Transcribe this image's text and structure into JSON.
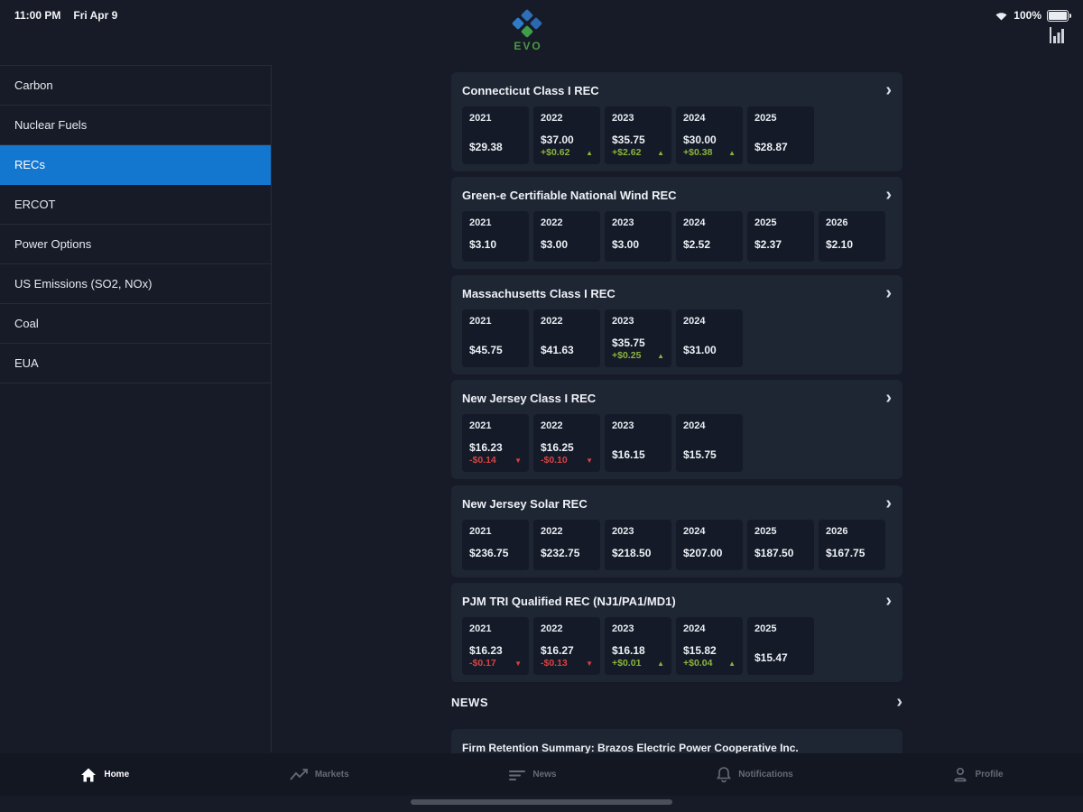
{
  "status_bar": {
    "time": "11:00 PM",
    "date": "Fri Apr 9",
    "battery_percent": "100%"
  },
  "header": {
    "brand": "EVO"
  },
  "icons": {
    "chevron_right": "›",
    "up_arrow": "▲",
    "down_arrow": "▼"
  },
  "colors": {
    "accent_blue": "#1377cf",
    "up_green": "#8ab43c",
    "down_red": "#d84343",
    "page_bg": "#171b27",
    "card_bg": "#1e2533",
    "cell_bg": "#141a27"
  },
  "sidebar": {
    "items": [
      {
        "label": "Carbon",
        "selected": false
      },
      {
        "label": "Nuclear Fuels",
        "selected": false
      },
      {
        "label": "RECs",
        "selected": true
      },
      {
        "label": "ERCOT",
        "selected": false
      },
      {
        "label": "Power Options",
        "selected": false
      },
      {
        "label": "US Emissions (SO2, NOx)",
        "selected": false
      },
      {
        "label": "Coal",
        "selected": false
      },
      {
        "label": "EUA",
        "selected": false
      }
    ]
  },
  "main": {
    "cards": [
      {
        "title": "Connecticut Class I REC",
        "cells": [
          {
            "year": "2021",
            "price": "$29.38",
            "change": "",
            "direction": ""
          },
          {
            "year": "2022",
            "price": "$37.00",
            "change": "+$0.62",
            "direction": "up"
          },
          {
            "year": "2023",
            "price": "$35.75",
            "change": "+$2.62",
            "direction": "up"
          },
          {
            "year": "2024",
            "price": "$30.00",
            "change": "+$0.38",
            "direction": "up"
          },
          {
            "year": "2025",
            "price": "$28.87",
            "change": "",
            "direction": ""
          }
        ]
      },
      {
        "title": "Green-e Certifiable National Wind REC",
        "cells": [
          {
            "year": "2021",
            "price": "$3.10",
            "change": "",
            "direction": ""
          },
          {
            "year": "2022",
            "price": "$3.00",
            "change": "",
            "direction": ""
          },
          {
            "year": "2023",
            "price": "$3.00",
            "change": "",
            "direction": ""
          },
          {
            "year": "2024",
            "price": "$2.52",
            "change": "",
            "direction": ""
          },
          {
            "year": "2025",
            "price": "$2.37",
            "change": "",
            "direction": ""
          },
          {
            "year": "2026",
            "price": "$2.10",
            "change": "",
            "direction": ""
          }
        ]
      },
      {
        "title": "Massachusetts Class I REC",
        "cells": [
          {
            "year": "2021",
            "price": "$45.75",
            "change": "",
            "direction": ""
          },
          {
            "year": "2022",
            "price": "$41.63",
            "change": "",
            "direction": ""
          },
          {
            "year": "2023",
            "price": "$35.75",
            "change": "+$0.25",
            "direction": "up"
          },
          {
            "year": "2024",
            "price": "$31.00",
            "change": "",
            "direction": ""
          }
        ]
      },
      {
        "title": "New Jersey Class I REC",
        "cells": [
          {
            "year": "2021",
            "price": "$16.23",
            "change": "-$0.14",
            "direction": "down"
          },
          {
            "year": "2022",
            "price": "$16.25",
            "change": "-$0.10",
            "direction": "down"
          },
          {
            "year": "2023",
            "price": "$16.15",
            "change": "",
            "direction": ""
          },
          {
            "year": "2024",
            "price": "$15.75",
            "change": "",
            "direction": ""
          }
        ]
      },
      {
        "title": "New Jersey Solar REC",
        "cells": [
          {
            "year": "2021",
            "price": "$236.75",
            "change": "",
            "direction": ""
          },
          {
            "year": "2022",
            "price": "$232.75",
            "change": "",
            "direction": ""
          },
          {
            "year": "2023",
            "price": "$218.50",
            "change": "",
            "direction": ""
          },
          {
            "year": "2024",
            "price": "$207.00",
            "change": "",
            "direction": ""
          },
          {
            "year": "2025",
            "price": "$187.50",
            "change": "",
            "direction": ""
          },
          {
            "year": "2026",
            "price": "$167.75",
            "change": "",
            "direction": ""
          }
        ]
      },
      {
        "title": "PJM TRI Qualified REC (NJ1/PA1/MD1)",
        "cells": [
          {
            "year": "2021",
            "price": "$16.23",
            "change": "-$0.17",
            "direction": "down"
          },
          {
            "year": "2022",
            "price": "$16.27",
            "change": "-$0.13",
            "direction": "down"
          },
          {
            "year": "2023",
            "price": "$16.18",
            "change": "+$0.01",
            "direction": "up"
          },
          {
            "year": "2024",
            "price": "$15.82",
            "change": "+$0.04",
            "direction": "up"
          },
          {
            "year": "2025",
            "price": "$15.47",
            "change": "",
            "direction": ""
          }
        ]
      }
    ]
  },
  "news": {
    "title": "NEWS",
    "items": [
      {
        "title": "Firm Retention Summary: Brazos Electric Power Cooperative Inc."
      }
    ]
  },
  "bottom_nav": {
    "items": [
      {
        "label": "Home",
        "active": true
      },
      {
        "label": "Markets",
        "active": false
      },
      {
        "label": "News",
        "active": false
      },
      {
        "label": "Notifications",
        "active": false
      },
      {
        "label": "Profile",
        "active": false
      }
    ]
  }
}
